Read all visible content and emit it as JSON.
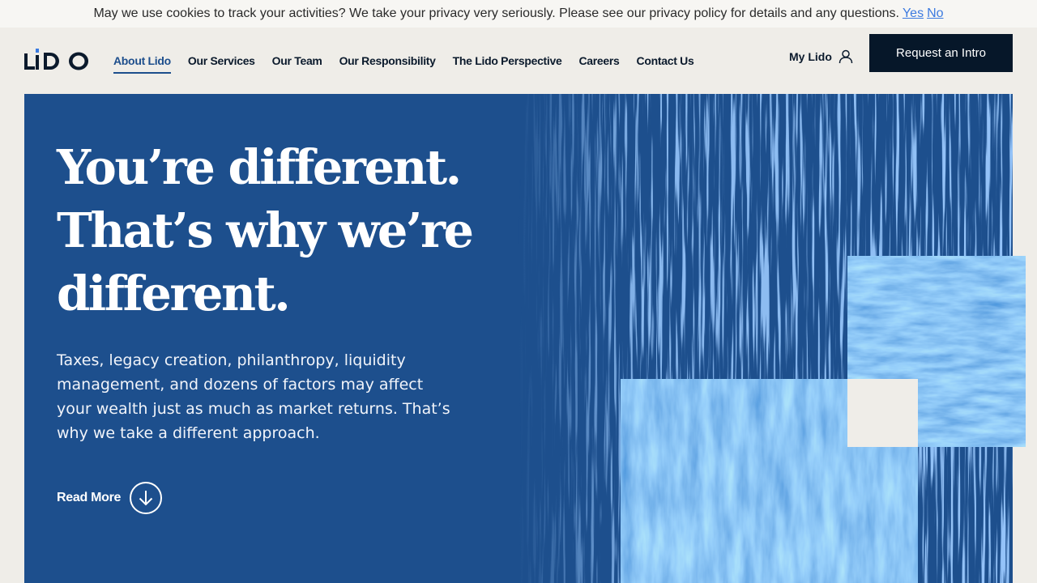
{
  "cookie": {
    "text": "May we use cookies to track your activities? We take your privacy very seriously. Please see our privacy policy for details and any questions.",
    "yes": "Yes",
    "no": "No"
  },
  "header": {
    "logo_text": "LIDO",
    "nav": [
      "About Lido",
      "Our Services",
      "Our Team",
      "Our Responsibility",
      "The Lido Perspective",
      "Careers",
      "Contact Us"
    ],
    "active_nav": "About Lido",
    "my_lido": "My Lido",
    "cta": "Request an Intro"
  },
  "hero": {
    "headline": [
      "You’re different.",
      "That’s why we’re",
      "different."
    ],
    "subtext": "Taxes, legacy creation, philanthropy, liquidity management, and dozens of factors may affect your wealth just as much as market returns. That’s why we take a different approach.",
    "read_more": "Read More"
  },
  "colors": {
    "hero_bg": "#1d4f8d",
    "paint_blue": "#3a7be0",
    "cta_bg": "#061729",
    "page_bg": "#efede8",
    "link_blue": "#3d7be0"
  }
}
